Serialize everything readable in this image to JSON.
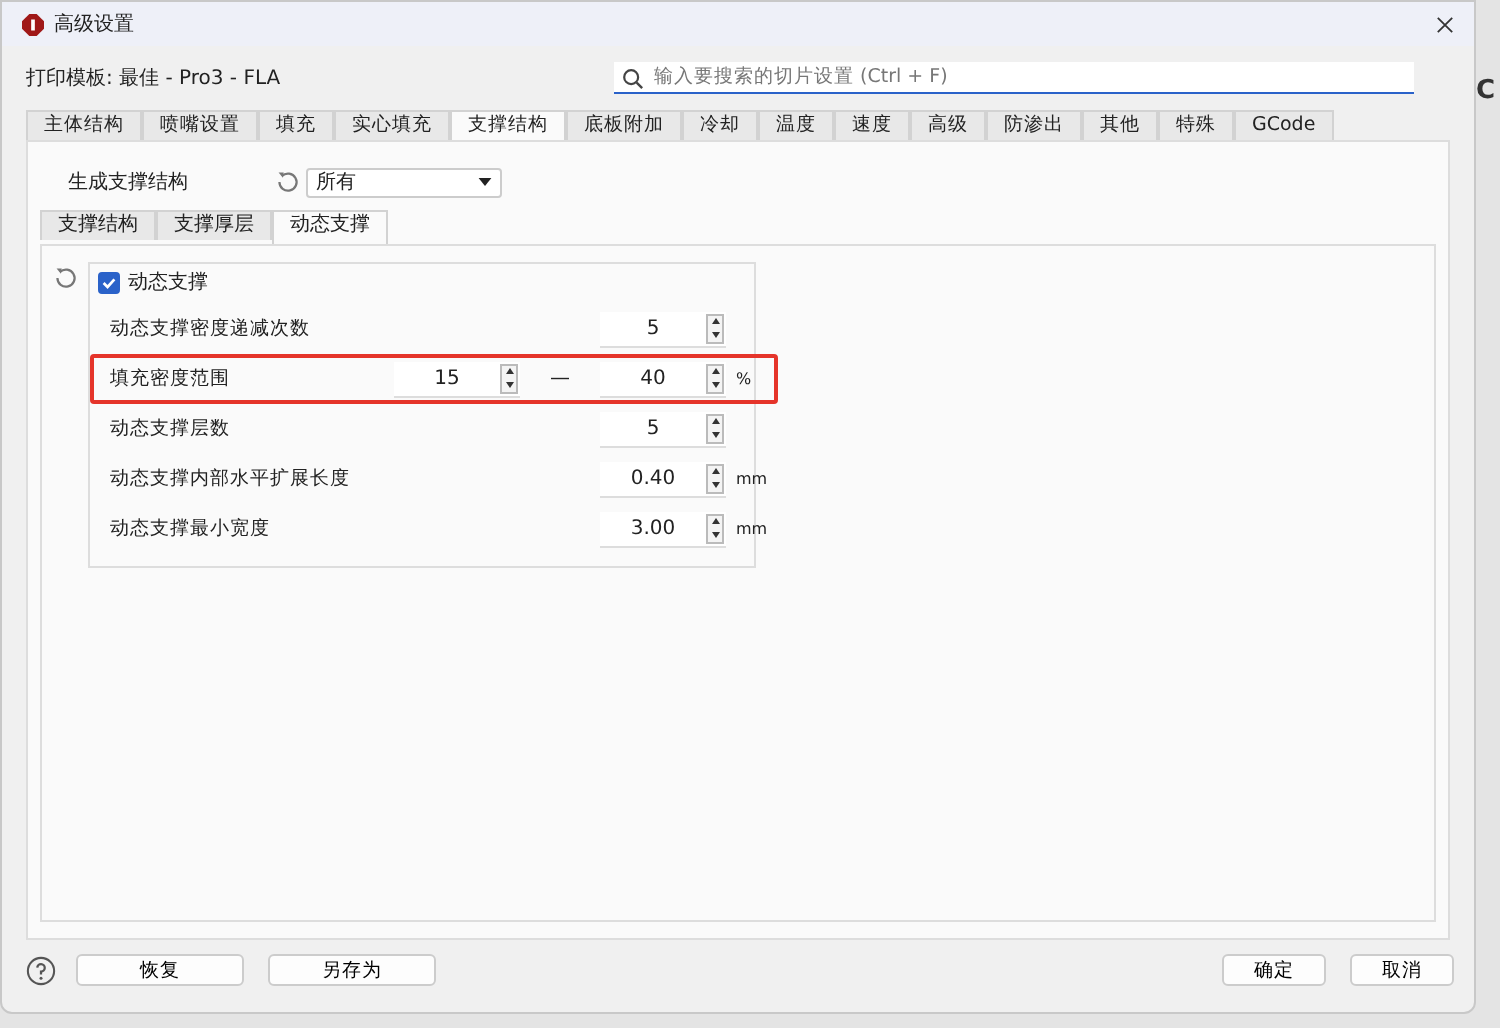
{
  "window": {
    "title": "高级设置"
  },
  "template": {
    "label": "打印模板: 最佳 - Pro3 - FLA"
  },
  "search": {
    "placeholder": "输入要搜索的切片设置 (Ctrl + F)"
  },
  "tabs": [
    {
      "label": "主体结构",
      "selected": false
    },
    {
      "label": "喷嘴设置",
      "selected": false
    },
    {
      "label": "填充",
      "selected": false
    },
    {
      "label": "实心填充",
      "selected": false
    },
    {
      "label": "支撑结构",
      "selected": true
    },
    {
      "label": "底板附加",
      "selected": false
    },
    {
      "label": "冷却",
      "selected": false
    },
    {
      "label": "温度",
      "selected": false
    },
    {
      "label": "速度",
      "selected": false
    },
    {
      "label": "高级",
      "selected": false
    },
    {
      "label": "防渗出",
      "selected": false
    },
    {
      "label": "其他",
      "selected": false
    },
    {
      "label": "特殊",
      "selected": false
    },
    {
      "label": "GCode",
      "selected": false
    }
  ],
  "generate": {
    "label": "生成支撑结构",
    "value": "所有"
  },
  "subtabs": [
    {
      "label": "支撑结构",
      "selected": false
    },
    {
      "label": "支撑厚层",
      "selected": false
    },
    {
      "label": "动态支撑",
      "selected": true
    }
  ],
  "group": {
    "label": "动态支撑",
    "checked": true,
    "rows": [
      {
        "kind": "single",
        "label": "动态支撑密度递减次数",
        "value": "5",
        "highlighted": false
      },
      {
        "kind": "range",
        "label": "填充密度范围",
        "from": "15",
        "separator": "—",
        "to": "40",
        "unit": "%",
        "highlighted": true
      },
      {
        "kind": "single",
        "label": "动态支撑层数",
        "value": "5",
        "highlighted": false
      },
      {
        "kind": "single",
        "label": "动态支撑内部水平扩展长度",
        "value": "0.40",
        "unit": "mm",
        "highlighted": false
      },
      {
        "kind": "single",
        "label": "动态支撑最小宽度",
        "value": "3.00",
        "unit": "mm",
        "highlighted": false
      }
    ]
  },
  "footer": {
    "left": [
      "恢复",
      "另存为"
    ],
    "right": [
      "确定",
      "取消"
    ]
  },
  "background": {
    "text": "C"
  }
}
